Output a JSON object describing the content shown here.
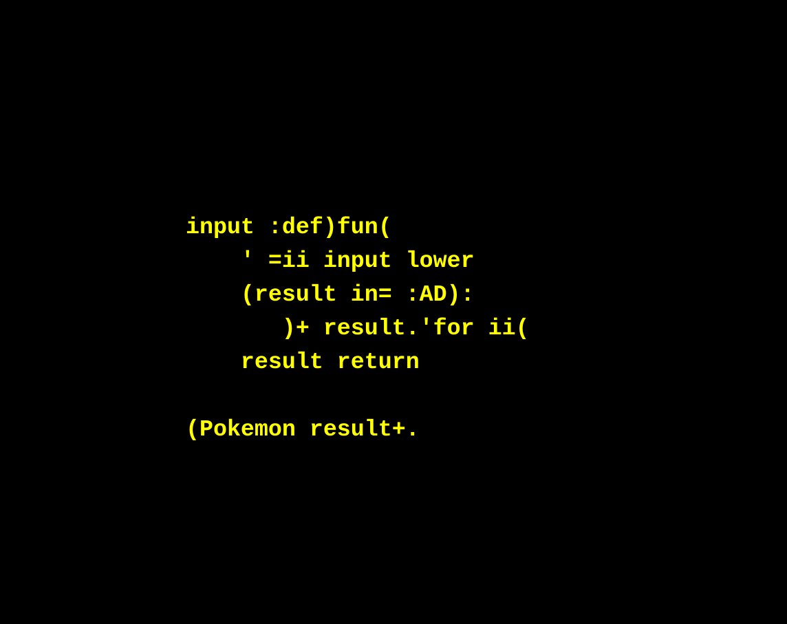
{
  "theme": {
    "background": "#000000",
    "text_color": "#ffff00"
  },
  "code": {
    "lines": [
      "input :def)fun(",
      "    ' =ii input lower",
      "    (result in= :AD):",
      "       )+ result.'for ii(",
      "    result return",
      "",
      "(Pokemon result+."
    ]
  }
}
